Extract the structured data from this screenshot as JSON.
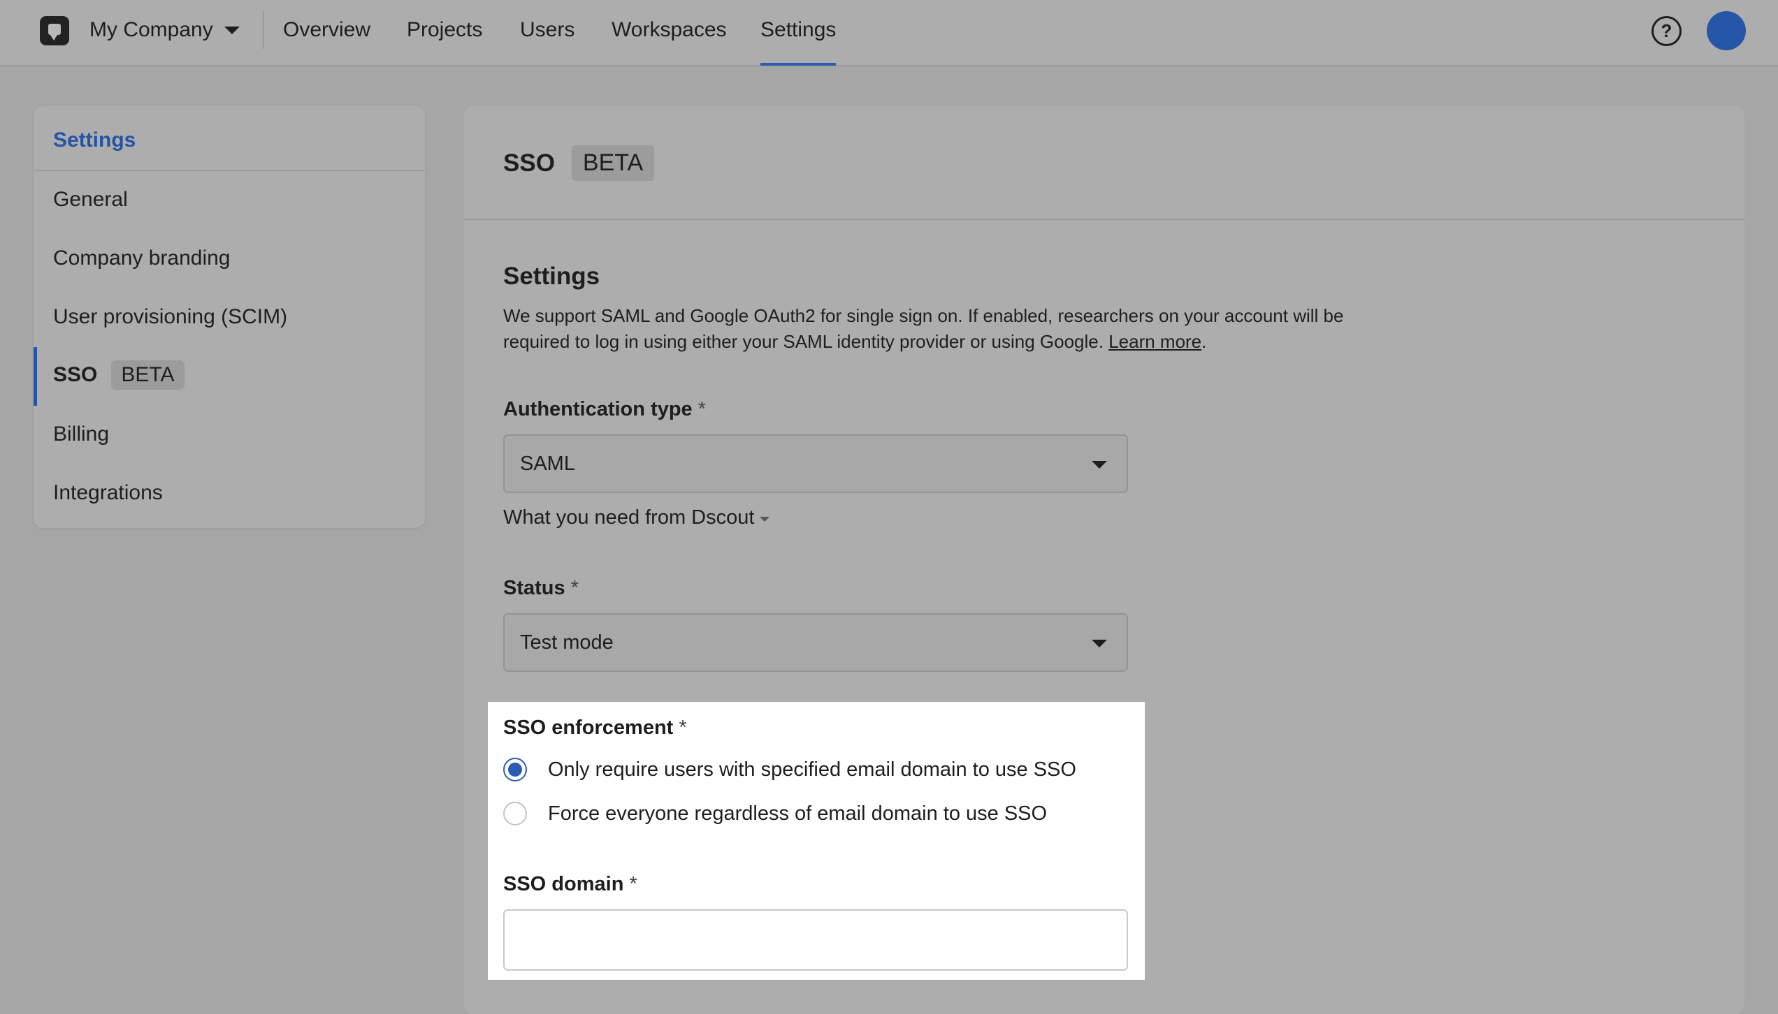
{
  "topnav": {
    "company": "My Company",
    "items": [
      "Overview",
      "Projects",
      "Users",
      "Workspaces",
      "Settings"
    ],
    "active": "Settings"
  },
  "sidebar": {
    "title": "Settings",
    "items": [
      {
        "label": "General"
      },
      {
        "label": "Company branding"
      },
      {
        "label": "User provisioning (SCIM)"
      },
      {
        "label": "SSO",
        "badge": "BETA",
        "active": true
      },
      {
        "label": "Billing"
      },
      {
        "label": "Integrations"
      }
    ]
  },
  "main": {
    "title": "SSO",
    "badge": "BETA",
    "section_title": "Settings",
    "description": "We support SAML and Google OAuth2 for single sign on. If enabled, researchers on your account will be required to log in using either your SAML identity provider or using Google.",
    "learn_more": "Learn more",
    "auth_type": {
      "label": "Authentication type",
      "required": "*",
      "value": "SAML"
    },
    "hint": "What you need from Dscout",
    "status": {
      "label": "Status",
      "required": "*",
      "value": "Test mode"
    },
    "enforcement": {
      "label": "SSO enforcement",
      "required": "*",
      "options": [
        {
          "label": "Only require users with specified email domain to use SSO",
          "checked": true
        },
        {
          "label": "Force everyone regardless of email domain to use SSO",
          "checked": false
        }
      ]
    },
    "domain": {
      "label": "SSO domain",
      "required": "*",
      "value": ""
    }
  },
  "colors": {
    "accent": "#2b5cb3",
    "avatar": "#2556a8"
  }
}
